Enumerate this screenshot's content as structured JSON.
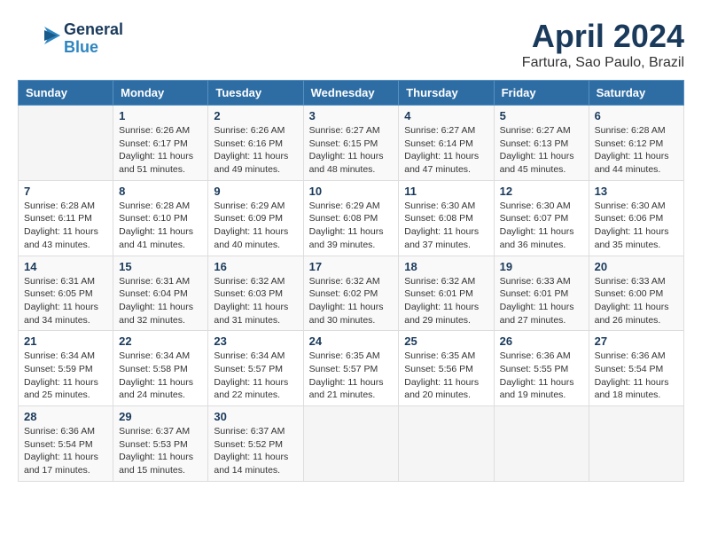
{
  "logo": {
    "general": "General",
    "blue": "Blue"
  },
  "title": "April 2024",
  "location": "Fartura, Sao Paulo, Brazil",
  "headers": [
    "Sunday",
    "Monday",
    "Tuesday",
    "Wednesday",
    "Thursday",
    "Friday",
    "Saturday"
  ],
  "weeks": [
    [
      {
        "day": "",
        "info": ""
      },
      {
        "day": "1",
        "info": "Sunrise: 6:26 AM\nSunset: 6:17 PM\nDaylight: 11 hours\nand 51 minutes."
      },
      {
        "day": "2",
        "info": "Sunrise: 6:26 AM\nSunset: 6:16 PM\nDaylight: 11 hours\nand 49 minutes."
      },
      {
        "day": "3",
        "info": "Sunrise: 6:27 AM\nSunset: 6:15 PM\nDaylight: 11 hours\nand 48 minutes."
      },
      {
        "day": "4",
        "info": "Sunrise: 6:27 AM\nSunset: 6:14 PM\nDaylight: 11 hours\nand 47 minutes."
      },
      {
        "day": "5",
        "info": "Sunrise: 6:27 AM\nSunset: 6:13 PM\nDaylight: 11 hours\nand 45 minutes."
      },
      {
        "day": "6",
        "info": "Sunrise: 6:28 AM\nSunset: 6:12 PM\nDaylight: 11 hours\nand 44 minutes."
      }
    ],
    [
      {
        "day": "7",
        "info": "Sunrise: 6:28 AM\nSunset: 6:11 PM\nDaylight: 11 hours\nand 43 minutes."
      },
      {
        "day": "8",
        "info": "Sunrise: 6:28 AM\nSunset: 6:10 PM\nDaylight: 11 hours\nand 41 minutes."
      },
      {
        "day": "9",
        "info": "Sunrise: 6:29 AM\nSunset: 6:09 PM\nDaylight: 11 hours\nand 40 minutes."
      },
      {
        "day": "10",
        "info": "Sunrise: 6:29 AM\nSunset: 6:08 PM\nDaylight: 11 hours\nand 39 minutes."
      },
      {
        "day": "11",
        "info": "Sunrise: 6:30 AM\nSunset: 6:08 PM\nDaylight: 11 hours\nand 37 minutes."
      },
      {
        "day": "12",
        "info": "Sunrise: 6:30 AM\nSunset: 6:07 PM\nDaylight: 11 hours\nand 36 minutes."
      },
      {
        "day": "13",
        "info": "Sunrise: 6:30 AM\nSunset: 6:06 PM\nDaylight: 11 hours\nand 35 minutes."
      }
    ],
    [
      {
        "day": "14",
        "info": "Sunrise: 6:31 AM\nSunset: 6:05 PM\nDaylight: 11 hours\nand 34 minutes."
      },
      {
        "day": "15",
        "info": "Sunrise: 6:31 AM\nSunset: 6:04 PM\nDaylight: 11 hours\nand 32 minutes."
      },
      {
        "day": "16",
        "info": "Sunrise: 6:32 AM\nSunset: 6:03 PM\nDaylight: 11 hours\nand 31 minutes."
      },
      {
        "day": "17",
        "info": "Sunrise: 6:32 AM\nSunset: 6:02 PM\nDaylight: 11 hours\nand 30 minutes."
      },
      {
        "day": "18",
        "info": "Sunrise: 6:32 AM\nSunset: 6:01 PM\nDaylight: 11 hours\nand 29 minutes."
      },
      {
        "day": "19",
        "info": "Sunrise: 6:33 AM\nSunset: 6:01 PM\nDaylight: 11 hours\nand 27 minutes."
      },
      {
        "day": "20",
        "info": "Sunrise: 6:33 AM\nSunset: 6:00 PM\nDaylight: 11 hours\nand 26 minutes."
      }
    ],
    [
      {
        "day": "21",
        "info": "Sunrise: 6:34 AM\nSunset: 5:59 PM\nDaylight: 11 hours\nand 25 minutes."
      },
      {
        "day": "22",
        "info": "Sunrise: 6:34 AM\nSunset: 5:58 PM\nDaylight: 11 hours\nand 24 minutes."
      },
      {
        "day": "23",
        "info": "Sunrise: 6:34 AM\nSunset: 5:57 PM\nDaylight: 11 hours\nand 22 minutes."
      },
      {
        "day": "24",
        "info": "Sunrise: 6:35 AM\nSunset: 5:57 PM\nDaylight: 11 hours\nand 21 minutes."
      },
      {
        "day": "25",
        "info": "Sunrise: 6:35 AM\nSunset: 5:56 PM\nDaylight: 11 hours\nand 20 minutes."
      },
      {
        "day": "26",
        "info": "Sunrise: 6:36 AM\nSunset: 5:55 PM\nDaylight: 11 hours\nand 19 minutes."
      },
      {
        "day": "27",
        "info": "Sunrise: 6:36 AM\nSunset: 5:54 PM\nDaylight: 11 hours\nand 18 minutes."
      }
    ],
    [
      {
        "day": "28",
        "info": "Sunrise: 6:36 AM\nSunset: 5:54 PM\nDaylight: 11 hours\nand 17 minutes."
      },
      {
        "day": "29",
        "info": "Sunrise: 6:37 AM\nSunset: 5:53 PM\nDaylight: 11 hours\nand 15 minutes."
      },
      {
        "day": "30",
        "info": "Sunrise: 6:37 AM\nSunset: 5:52 PM\nDaylight: 11 hours\nand 14 minutes."
      },
      {
        "day": "",
        "info": ""
      },
      {
        "day": "",
        "info": ""
      },
      {
        "day": "",
        "info": ""
      },
      {
        "day": "",
        "info": ""
      }
    ]
  ]
}
